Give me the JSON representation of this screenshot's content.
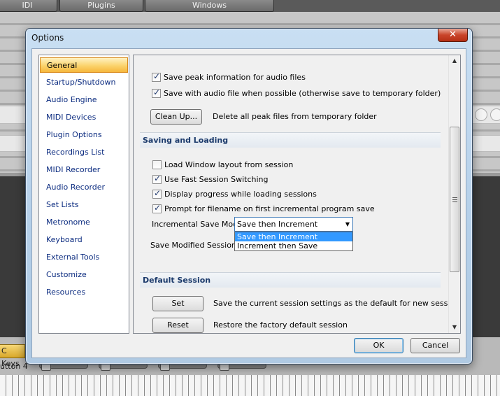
{
  "background": {
    "tabs": [
      "IDI",
      "Plugins",
      "Windows"
    ],
    "keys_button": "C Keys",
    "button_label": "utton 4"
  },
  "dialog": {
    "title": "Options",
    "close_glyph": "✕",
    "categories": [
      "General",
      "Startup/Shutdown",
      "Audio Engine",
      "MIDI Devices",
      "Plugin Options",
      "Recordings List",
      "MIDI Recorder",
      "Audio Recorder",
      "Set Lists",
      "Metronome",
      "Keyboard",
      "External Tools",
      "Customize",
      "Resources"
    ],
    "selected_category": "General",
    "peak": {
      "save_peak_info": {
        "label": "Save peak information for audio files",
        "checked": true
      },
      "save_with_audio": {
        "label": "Save with audio file when possible (otherwise save to temporary folder)",
        "checked": true
      },
      "cleanup_button": "Clean Up...",
      "cleanup_desc": "Delete all peak files from temporary folder"
    },
    "saving_loading": {
      "header": "Saving and Loading",
      "load_window_layout": {
        "label": "Load Window layout from session",
        "checked": false
      },
      "fast_switching": {
        "label": "Use Fast Session Switching",
        "checked": true
      },
      "display_progress": {
        "label": "Display progress while loading sessions",
        "checked": true
      },
      "prompt_filename": {
        "label": "Prompt for filename on first incremental program save",
        "checked": true
      },
      "incremental_label": "Incremental Save Mode:",
      "incremental_value": "Save then Increment",
      "incremental_options": [
        "Save then Increment",
        "Increment then Save"
      ],
      "modified_label": "Save Modified Sessions:"
    },
    "default_session": {
      "header": "Default Session",
      "set_button": "Set",
      "set_desc": "Save the current session settings as the default for new sessions",
      "reset_button": "Reset",
      "reset_desc": "Restore the factory default session"
    },
    "ok_button": "OK",
    "cancel_button": "Cancel"
  },
  "colors": {
    "selection_highlight": "#3399ff",
    "category_text": "#0c2c80",
    "section_header_text": "#1b3a6b",
    "close_button": "#c9442a"
  }
}
